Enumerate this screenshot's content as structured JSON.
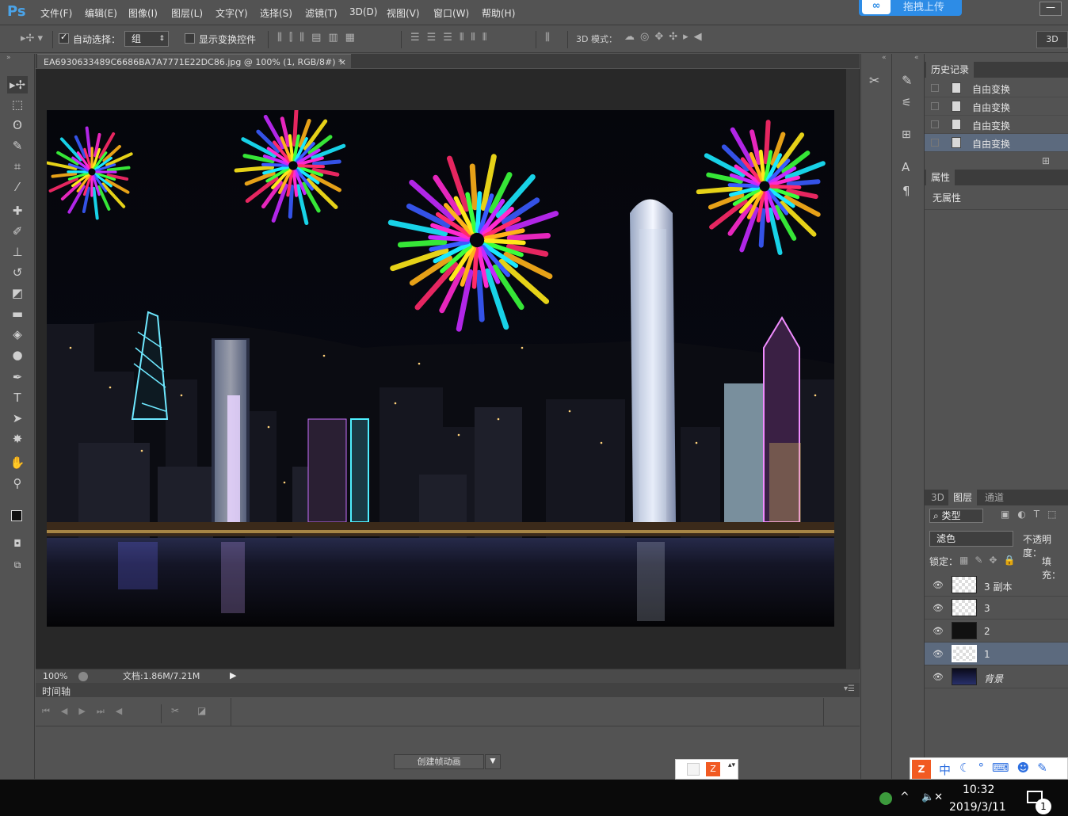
{
  "app": {
    "logo": "Ps"
  },
  "menu": [
    "文件(F)",
    "编辑(E)",
    "图像(I)",
    "图层(L)",
    "文字(Y)",
    "选择(S)",
    "滤镜(T)",
    "3D(D)",
    "视图(V)",
    "窗口(W)",
    "帮助(H)"
  ],
  "upload_badge": {
    "icon": "∞",
    "label": "拖拽上传"
  },
  "window": {
    "minimize": "—"
  },
  "options": {
    "auto_select_label": "自动选择：",
    "auto_select_value": "组",
    "show_transform_label": "显示变换控件",
    "mode_3d_label": "3D 模式：",
    "btn_3d": "3D"
  },
  "document": {
    "tab_title": "EA6930633489C6686BA7A7771E22DC86.jpg @ 100% (1, RGB/8#) *",
    "close": "×"
  },
  "status": {
    "zoom": "100%",
    "doc_info": "文档:1.86M/7.21M"
  },
  "timeline": {
    "title": "时间轴",
    "create_button": "创建帧动画"
  },
  "history_panel": {
    "tab": "历史记录",
    "items": [
      "自由变换",
      "自由变换",
      "自由变换",
      "自由变换"
    ]
  },
  "properties_panel": {
    "tab": "属性",
    "empty_text": "无属性"
  },
  "layers_panel": {
    "tabs": [
      "3D",
      "图层",
      "通道"
    ],
    "filter_kind": "类型",
    "blend_mode": "滤色",
    "opacity_label": "不透明度：",
    "lock_label": "锁定：",
    "fill_label": "填充：",
    "layers": [
      "3 副本",
      "3",
      "2",
      "1",
      "背景"
    ]
  },
  "taskbar": {
    "time": "10:32",
    "date": "2019/3/11",
    "notification_count": "1"
  },
  "ime": {
    "lang": "中"
  },
  "colors": {
    "accent": "#2d8ce6",
    "panel": "#535353",
    "dark": "#282828",
    "selected": "#5c6a7e"
  }
}
